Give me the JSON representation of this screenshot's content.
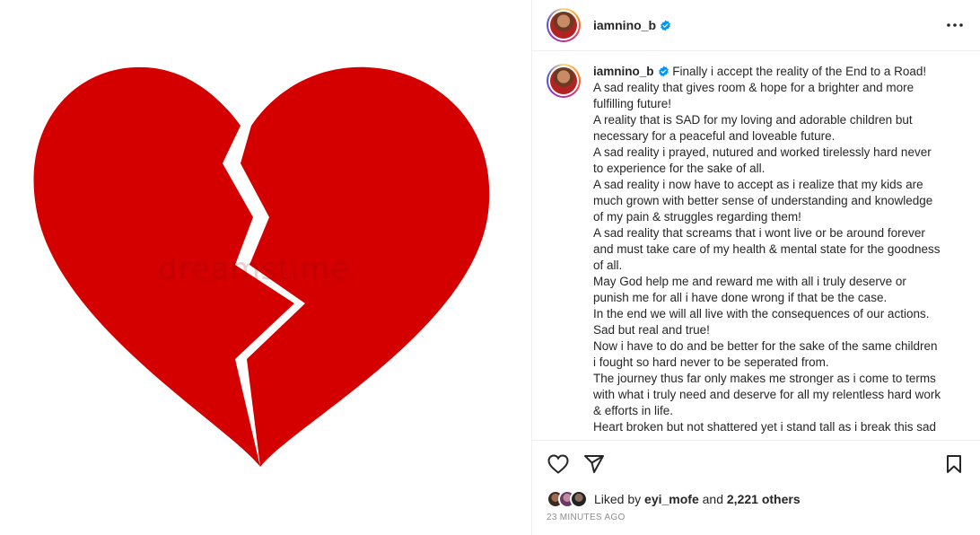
{
  "post": {
    "username": "iamnino_b",
    "verified": true,
    "watermark": "dreamstime",
    "caption_lines": [
      "Finally i accept the reality of the End to a Road!",
      "A sad reality that gives room & hope for a brighter and more",
      "fulfilling future!",
      "A reality that is SAD for my loving and adorable children but",
      "necessary for a peaceful and loveable future.",
      "A sad reality i prayed, nutured and worked tirelessly hard never",
      "to experience for the sake of all.",
      "A sad reality i now have to accept as i realize that my kids are",
      "much grown with better sense of understanding and knowledge",
      "of my pain & struggles regarding them!",
      "A sad reality that screams that i wont live or be around forever",
      "and must take care of my health & mental state for the goodness",
      "of all.",
      "May God help me and reward me with all i truly deserve or",
      "punish me for all i have done wrong if that be the case.",
      "In the end we will all live with the consequences of our actions.",
      "Sad but real and true!",
      "Now i have to do and be better for the sake of the same children",
      "i fought so hard never to be seperated from.",
      "The journey thus far only makes me stronger as i come to terms",
      "with what i truly need and deserve for all my relentless hard work",
      "& efforts in life.",
      "Heart broken but not shattered yet i stand tall as i break this sad"
    ],
    "likes": {
      "prefix": "Liked by",
      "first_user": "eyi_mofe",
      "joiner": "and",
      "others": "2,221 others"
    },
    "timestamp": "23 minutes ago"
  },
  "icons": {
    "more": "more-horizontal-icon",
    "like": "heart-outline-icon",
    "share": "paper-plane-icon",
    "save": "bookmark-icon",
    "verified": "verified-badge-icon"
  },
  "colors": {
    "heart_red": "#d40000",
    "verified_blue": "#0095f6",
    "text": "#262626",
    "muted": "#8e8e8e"
  }
}
